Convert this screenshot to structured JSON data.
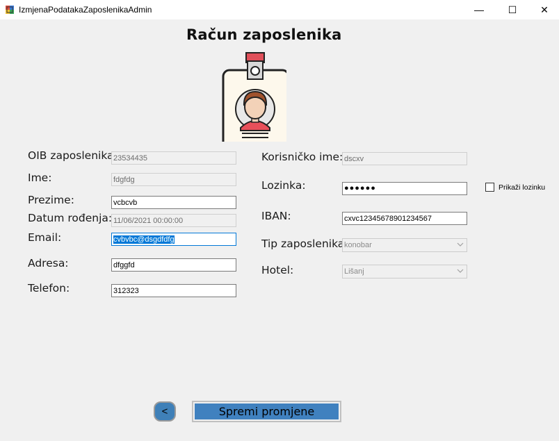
{
  "window": {
    "title": "IzmjenaPodatakaZaposlenikaAdmin",
    "minimize": "—",
    "maximize": "☐",
    "close": "✕"
  },
  "heading": "Račun zaposlenika",
  "left": {
    "oib_label": "OIB zaposlenika",
    "oib_value": "23534435",
    "ime_label": "Ime:",
    "ime_value": "fdgfdg",
    "prezime_label": "Prezime:",
    "prezime_value": "vcbcvb",
    "datum_label": "Datum rođenja:",
    "datum_value": "11/06/2021 00:00:00",
    "email_label": "Email:",
    "email_value": "cvbvbc@dsgdfdfg",
    "adresa_label": "Adresa:",
    "adresa_value": "dfggfd",
    "telefon_label": "Telefon:",
    "telefon_value": "312323"
  },
  "right": {
    "korisnicko_label": "Korisničko ime:",
    "korisnicko_value": "dscxv",
    "lozinka_label": "Lozinka:",
    "lozinka_value": "●●●●●●",
    "show_password_label": "Prikaži lozinku",
    "iban_label": "IBAN:",
    "iban_value": "cxvc12345678901234567",
    "tip_label": "Tip zaposlenika",
    "tip_value": "konobar",
    "hotel_label": "Hotel:",
    "hotel_value": "Lišanj"
  },
  "buttons": {
    "back": "<",
    "save": "Spremi promjene"
  },
  "icons": {
    "app": "app-icon",
    "badge": "employee-badge-icon",
    "dropdown": "chevron-down-icon"
  },
  "colors": {
    "accent": "#4081bf",
    "selection": "#0078d7",
    "badge_clip": "#e0505a",
    "badge_face_hair": "#a0522d"
  }
}
